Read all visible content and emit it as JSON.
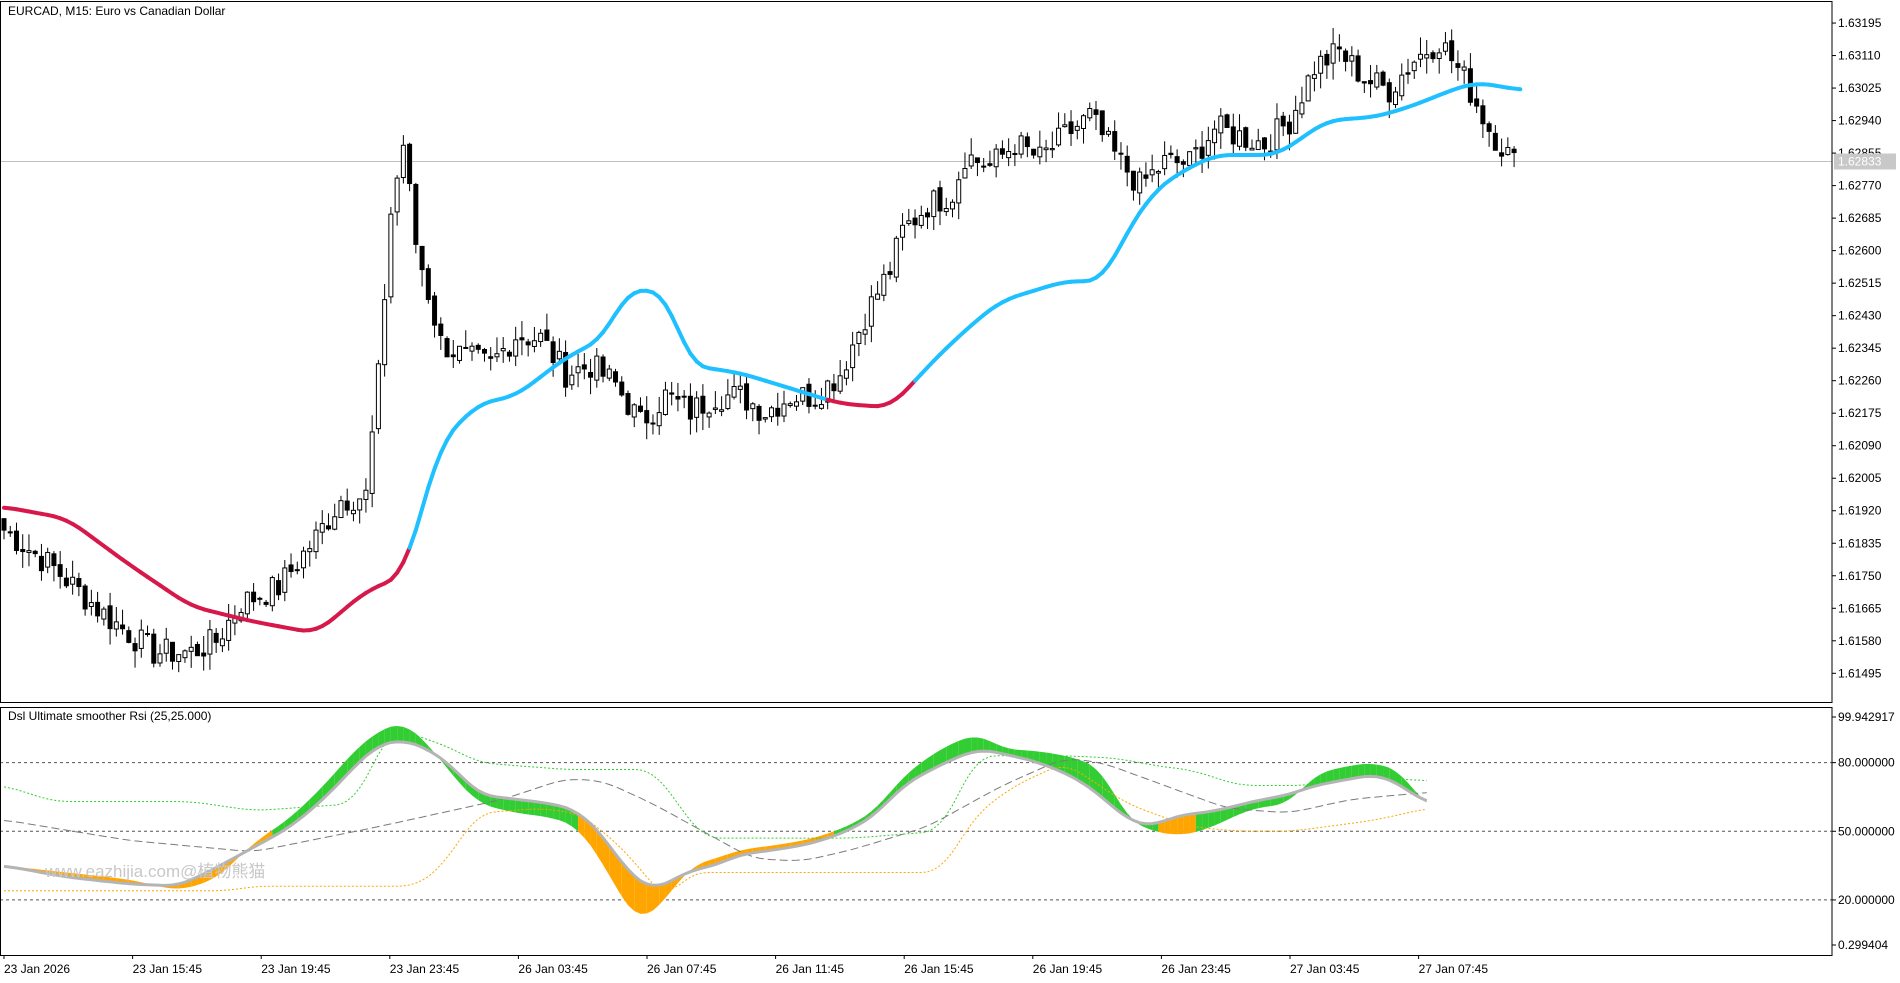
{
  "window": {
    "symbol_label": "EURCAD, M15:  Euro vs Canadian Dollar",
    "indicator_label": "Dsl Ultimate smoother Rsi (25,25.000)",
    "watermark": "www.eazhijia.com@植物熊猫"
  },
  "price_pane": {
    "current_price": "1.62833",
    "y_ticks": [
      "1.63195",
      "1.63110",
      "1.63025",
      "1.62940",
      "1.62855",
      "1.62770",
      "1.62685",
      "1.62600",
      "1.62515",
      "1.62430",
      "1.62345",
      "1.62260",
      "1.62175",
      "1.62090",
      "1.62005",
      "1.61920",
      "1.61835",
      "1.61750",
      "1.61665",
      "1.61580",
      "1.61495"
    ]
  },
  "indicator_pane": {
    "y_ticks": [
      "99.942917",
      "80.000000",
      "50.000000",
      "20.000000",
      "0.299404"
    ]
  },
  "x_ticks": [
    "23 Jan 2026",
    "23 Jan 15:45",
    "23 Jan 19:45",
    "23 Jan 23:45",
    "26 Jan 03:45",
    "26 Jan 07:45",
    "26 Jan 11:45",
    "26 Jan 15:45",
    "26 Jan 19:45",
    "26 Jan 23:45",
    "27 Jan 03:45",
    "27 Jan 07:45"
  ],
  "colors": {
    "bull_candle": "#ffffff",
    "bear_candle": "#000000",
    "ma_up": "#1ec0ff",
    "ma_down": "#d6184a",
    "rsi_up_fill": "#32cd32",
    "rsi_down_fill": "#ffa500",
    "rsi_line": "#b4b4b4",
    "upper_level": "#32cd32",
    "lower_level": "#ffa500"
  },
  "chart_data": [
    {
      "type": "candlestick",
      "title": "EURCAD, M15:  Euro vs Canadian Dollar",
      "ylim": [
        1.6142,
        1.6325
      ],
      "x_tick_labels": [
        "23 Jan 2026",
        "23 Jan 15:45",
        "23 Jan 19:45",
        "23 Jan 23:45",
        "26 Jan 03:45",
        "26 Jan 07:45",
        "26 Jan 11:45",
        "26 Jan 15:45",
        "26 Jan 19:45",
        "26 Jan 23:45",
        "27 Jan 03:45",
        "27 Jan 07:45"
      ],
      "anchors": {
        "close": [
          [
            0,
            1.6187
          ],
          [
            8,
            1.6177
          ],
          [
            16,
            1.6165
          ],
          [
            24,
            1.6155
          ],
          [
            30,
            1.6155
          ],
          [
            34,
            1.6158
          ],
          [
            38,
            1.6168
          ],
          [
            44,
            1.6172
          ],
          [
            50,
            1.6185
          ],
          [
            54,
            1.6195
          ],
          [
            58,
            1.6196
          ],
          [
            60,
            1.6227
          ],
          [
            62,
            1.627
          ],
          [
            64,
            1.6288
          ],
          [
            66,
            1.6262
          ],
          [
            68,
            1.6249
          ],
          [
            70,
            1.6236
          ],
          [
            74,
            1.6232
          ],
          [
            78,
            1.623
          ],
          [
            82,
            1.6238
          ],
          [
            86,
            1.6237
          ],
          [
            90,
            1.6228
          ],
          [
            94,
            1.623
          ],
          [
            98,
            1.6225
          ],
          [
            102,
            1.6215
          ],
          [
            106,
            1.6222
          ],
          [
            110,
            1.6218
          ],
          [
            114,
            1.6222
          ],
          [
            118,
            1.6222
          ],
          [
            122,
            1.6218
          ],
          [
            126,
            1.6222
          ],
          [
            130,
            1.6222
          ],
          [
            134,
            1.6228
          ],
          [
            138,
            1.6243
          ],
          [
            142,
            1.6255
          ],
          [
            144,
            1.6265
          ],
          [
            148,
            1.6272
          ],
          [
            152,
            1.6275
          ],
          [
            154,
            1.6285
          ],
          [
            158,
            1.6282
          ],
          [
            162,
            1.6288
          ],
          [
            166,
            1.6284
          ],
          [
            170,
            1.629
          ],
          [
            174,
            1.6295
          ],
          [
            178,
            1.6285
          ],
          [
            182,
            1.6277
          ],
          [
            186,
            1.6283
          ],
          [
            190,
            1.6283
          ],
          [
            194,
            1.6292
          ],
          [
            198,
            1.629
          ],
          [
            202,
            1.6288
          ],
          [
            206,
            1.6294
          ],
          [
            210,
            1.6308
          ],
          [
            214,
            1.6312
          ],
          [
            218,
            1.6305
          ],
          [
            222,
            1.6302
          ],
          [
            226,
            1.631
          ],
          [
            230,
            1.6315
          ],
          [
            234,
            1.6305
          ],
          [
            238,
            1.6292
          ],
          [
            242,
            1.6283
          ]
        ]
      },
      "candles": {
        "count": 243,
        "seed": 7
      },
      "moving_average": {
        "name": "",
        "points": [
          [
            0,
            1.6193
          ],
          [
            10,
            1.619
          ],
          [
            20,
            1.6178
          ],
          [
            30,
            1.6167
          ],
          [
            40,
            1.6163
          ],
          [
            50,
            1.616
          ],
          [
            58,
            1.6171
          ],
          [
            64,
            1.6175
          ],
          [
            70,
            1.621
          ],
          [
            76,
            1.622
          ],
          [
            82,
            1.6222
          ],
          [
            90,
            1.6232
          ],
          [
            96,
            1.6237
          ],
          [
            100,
            1.625
          ],
          [
            106,
            1.6249
          ],
          [
            110,
            1.623
          ],
          [
            118,
            1.6228
          ],
          [
            126,
            1.6224
          ],
          [
            134,
            1.622
          ],
          [
            142,
            1.6219
          ],
          [
            150,
            1.6233
          ],
          [
            156,
            1.6242
          ],
          [
            160,
            1.6247
          ],
          [
            166,
            1.625
          ],
          [
            170,
            1.6252
          ],
          [
            176,
            1.6252
          ],
          [
            180,
            1.6265
          ],
          [
            184,
            1.6275
          ],
          [
            188,
            1.628
          ],
          [
            194,
            1.6285
          ],
          [
            204,
            1.6285
          ],
          [
            212,
            1.6294
          ],
          [
            220,
            1.6295
          ],
          [
            226,
            1.6298
          ],
          [
            232,
            1.6302
          ],
          [
            236,
            1.6304
          ],
          [
            243,
            1.6302
          ]
        ],
        "down_segments": [
          [
            0,
            64
          ],
          [
            132,
            145
          ]
        ]
      }
    },
    {
      "type": "line",
      "title": "Dsl Ultimate smoother Rsi (25,25.000)",
      "ylim": [
        0.299404,
        99.942917
      ],
      "levels": [
        80,
        50,
        20
      ],
      "series": [
        {
          "name": "rsi",
          "points": [
            [
              0,
              35
            ],
            [
              10,
              32
            ],
            [
              20,
              29
            ],
            [
              28,
              24
            ],
            [
              34,
              29
            ],
            [
              40,
              45
            ],
            [
              46,
              56
            ],
            [
              52,
              72
            ],
            [
              56,
              85
            ],
            [
              60,
              94
            ],
            [
              64,
              98
            ],
            [
              68,
              88
            ],
            [
              72,
              74
            ],
            [
              76,
              62
            ],
            [
              82,
              58
            ],
            [
              88,
              56
            ],
            [
              92,
              52
            ],
            [
              96,
              36
            ],
            [
              100,
              16
            ],
            [
              102,
              10
            ],
            [
              106,
              20
            ],
            [
              110,
              35
            ],
            [
              114,
              38
            ],
            [
              118,
              42
            ],
            [
              124,
              44
            ],
            [
              130,
              47
            ],
            [
              136,
              53
            ],
            [
              140,
              60
            ],
            [
              144,
              74
            ],
            [
              150,
              86
            ],
            [
              156,
              93
            ],
            [
              160,
              86
            ],
            [
              166,
              85
            ],
            [
              172,
              82
            ],
            [
              176,
              77
            ],
            [
              180,
              55
            ],
            [
              184,
              50
            ],
            [
              188,
              48
            ],
            [
              192,
              50
            ],
            [
              196,
              55
            ],
            [
              200,
              60
            ],
            [
              206,
              62
            ],
            [
              210,
              75
            ],
            [
              216,
              79
            ],
            [
              220,
              80
            ],
            [
              224,
              76
            ],
            [
              228,
              60
            ]
          ]
        },
        {
          "name": "smoothed",
          "points": [
            [
              0,
              35
            ],
            [
              10,
              30
            ],
            [
              20,
              27
            ],
            [
              28,
              26
            ],
            [
              34,
              34
            ],
            [
              40,
              43
            ],
            [
              46,
              52
            ],
            [
              52,
              66
            ],
            [
              56,
              78
            ],
            [
              60,
              88
            ],
            [
              64,
              90
            ],
            [
              68,
              86
            ],
            [
              72,
              78
            ],
            [
              76,
              66
            ],
            [
              82,
              64
            ],
            [
              88,
              62
            ],
            [
              92,
              59
            ],
            [
              96,
              48
            ],
            [
              100,
              32
            ],
            [
              104,
              24
            ],
            [
              110,
              33
            ],
            [
              114,
              35
            ],
            [
              118,
              40
            ],
            [
              124,
              42
            ],
            [
              130,
              45
            ],
            [
              136,
              51
            ],
            [
              140,
              58
            ],
            [
              144,
              70
            ],
            [
              150,
              79
            ],
            [
              156,
              86
            ],
            [
              160,
              84
            ],
            [
              166,
              80
            ],
            [
              172,
              73
            ],
            [
              176,
              65
            ],
            [
              180,
              55
            ],
            [
              184,
              52
            ],
            [
              188,
              57
            ],
            [
              192,
              58
            ],
            [
              196,
              60
            ],
            [
              200,
              63
            ],
            [
              206,
              66
            ],
            [
              210,
              70
            ],
            [
              216,
              73
            ],
            [
              220,
              75
            ],
            [
              224,
              70
            ],
            [
              228,
              62
            ]
          ]
        },
        {
          "name": "slow",
          "points": [
            [
              0,
              55
            ],
            [
              20,
              46
            ],
            [
              40,
              41
            ],
            [
              60,
              52
            ],
            [
              80,
              64
            ],
            [
              90,
              73
            ],
            [
              96,
              72
            ],
            [
              104,
              62
            ],
            [
              112,
              50
            ],
            [
              120,
              38
            ],
            [
              128,
              37
            ],
            [
              136,
              42
            ],
            [
              148,
              52
            ],
            [
              160,
              70
            ],
            [
              170,
              82
            ],
            [
              176,
              80
            ],
            [
              186,
              70
            ],
            [
              196,
              60
            ],
            [
              206,
              58
            ],
            [
              216,
              64
            ],
            [
              228,
              67
            ]
          ]
        },
        {
          "name": "upper",
          "points": [
            [
              0,
              70
            ],
            [
              8,
              63
            ],
            [
              30,
              63
            ],
            [
              40,
              59
            ],
            [
              56,
              62
            ],
            [
              62,
              95
            ],
            [
              66,
              92
            ],
            [
              72,
              86
            ],
            [
              76,
              80
            ],
            [
              90,
              77
            ],
            [
              100,
              77
            ],
            [
              104,
              77
            ],
            [
              112,
              47
            ],
            [
              124,
              47
            ],
            [
              136,
              47
            ],
            [
              150,
              50
            ],
            [
              156,
              83
            ],
            [
              170,
              83
            ],
            [
              178,
              82
            ],
            [
              186,
              78
            ],
            [
              190,
              77
            ],
            [
              198,
              70
            ],
            [
              208,
              70
            ],
            [
              212,
              71
            ],
            [
              218,
              74
            ],
            [
              228,
              72
            ]
          ]
        },
        {
          "name": "lower",
          "points": [
            [
              0,
              24
            ],
            [
              20,
              24
            ],
            [
              36,
              24
            ],
            [
              40,
              26
            ],
            [
              60,
              26
            ],
            [
              66,
              26
            ],
            [
              70,
              34
            ],
            [
              76,
              58
            ],
            [
              86,
              60
            ],
            [
              92,
              58
            ],
            [
              96,
              50
            ],
            [
              100,
              40
            ],
            [
              106,
              20
            ],
            [
              110,
              32
            ],
            [
              120,
              32
            ],
            [
              136,
              32
            ],
            [
              150,
              32
            ],
            [
              156,
              58
            ],
            [
              162,
              70
            ],
            [
              170,
              80
            ],
            [
              180,
              62
            ],
            [
              190,
              52
            ],
            [
              198,
              50
            ],
            [
              206,
              50
            ],
            [
              212,
              52
            ],
            [
              220,
              55
            ],
            [
              228,
              60
            ]
          ]
        }
      ]
    }
  ]
}
